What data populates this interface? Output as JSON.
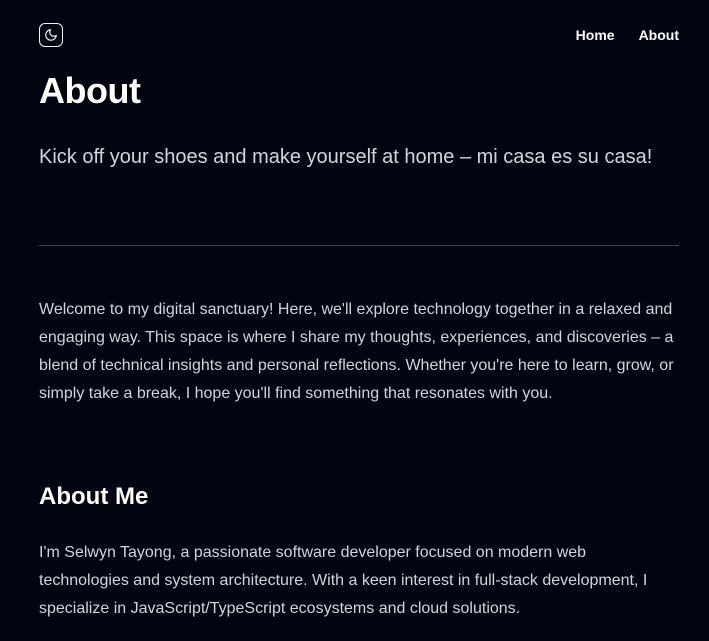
{
  "header": {
    "theme_toggle_icon": "moon-icon",
    "nav": [
      {
        "label": "Home"
      },
      {
        "label": "About"
      }
    ]
  },
  "main": {
    "title": "About",
    "subtitle": "Kick off your shoes and make yourself at home – mi casa es su casa!",
    "intro": "Welcome to my digital sanctuary! Here, we'll explore technology together in a relaxed and engaging way. This space is where I share my thoughts, experiences, and discoveries – a blend of technical insights and personal reflections. Whether you're here to learn, grow, or simply take a break, I hope you'll find something that resonates with you.",
    "about_me": {
      "heading": "About Me",
      "text": "I'm Selwyn Tayong, a passionate software developer focused on modern web technologies and system architecture. With a keen interest in full-stack development, I specialize in JavaScript/TypeScript ecosystems and cloud solutions."
    }
  },
  "colors": {
    "background": "#02040f",
    "heading": "#ffffff",
    "body_text": "#d1d5db",
    "divider": "#374151"
  }
}
